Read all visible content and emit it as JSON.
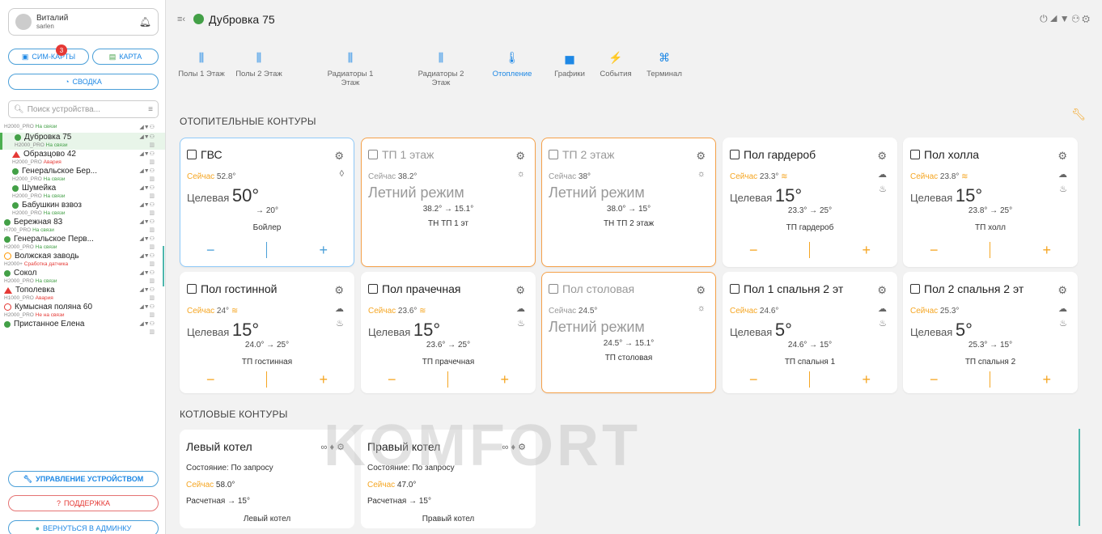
{
  "user": {
    "name": "Виталий",
    "login": "sarlen"
  },
  "sidebar": {
    "sim_label": "СИМ-КАРТЫ",
    "sim_badge": "3",
    "map_label": "КАРТА",
    "summary_label": "СВОДКА",
    "search_placeholder": "Поиск устройства...",
    "devices": [
      {
        "name": "",
        "model": "H2000_PRO",
        "status": "На связи",
        "state": "ok",
        "sub": false
      },
      {
        "name": "Дубровка 75",
        "model": "H2000_PRO",
        "status": "На связи",
        "state": "ok",
        "sub": true
      },
      {
        "name": "Образцово 42",
        "model": "H2000_PRO",
        "status": "Авария",
        "state": "alarm",
        "sub": true
      },
      {
        "name": "Генеральское Бер...",
        "model": "H2000_PRO",
        "status": "На связи",
        "state": "ok",
        "sub": true
      },
      {
        "name": "Шумейка",
        "model": "H2000_PRO",
        "status": "На связи",
        "state": "ok",
        "sub": true
      },
      {
        "name": "Бабушкин взвоз",
        "model": "H2000_PRO",
        "status": "На связи",
        "state": "ok",
        "sub": true
      },
      {
        "name": "Бережная 83",
        "model": "H700_PRO",
        "status": "На связи",
        "state": "ok",
        "sub": false
      },
      {
        "name": "Генеральское Перв...",
        "model": "H2000_PRO",
        "status": "На связи",
        "state": "ok",
        "sub": false
      },
      {
        "name": "Волжская заводь",
        "model": "H2000+",
        "status": "Сработка датчика",
        "state": "sensor",
        "sub": false
      },
      {
        "name": "Сокол",
        "model": "H2000_PRO",
        "status": "На связи",
        "state": "ok",
        "sub": false
      },
      {
        "name": "Тополевка",
        "model": "H1000_PRO",
        "status": "Авария",
        "state": "alarm",
        "sub": false
      },
      {
        "name": "Кумысная поляна 60",
        "model": "H2000_PRO",
        "status": "Не на связи",
        "state": "offline",
        "sub": false
      },
      {
        "name": "Пристанное Елена",
        "model": "",
        "status": "",
        "state": "ok",
        "sub": false
      }
    ],
    "manage_label": "УПРАВЛЕНИЕ УСТРОЙСТВОМ",
    "support_label": "ПОДДЕРЖКА",
    "admin_label": "ВЕРНУТЬСЯ В АДМИНКУ"
  },
  "header": {
    "title": "Дубровка 75"
  },
  "tabs": [
    {
      "label": "Полы 1 Этаж"
    },
    {
      "label": "Полы 2 Этаж"
    },
    {
      "label": "Радиаторы 1 Этаж"
    },
    {
      "label": "Радиаторы 2 Этаж"
    },
    {
      "label": "Отопление"
    },
    {
      "label": "Графики"
    },
    {
      "label": "События"
    },
    {
      "label": "Терминал"
    }
  ],
  "sections": {
    "heating": "ОТОПИТЕЛЬНЫЕ КОНТУРЫ",
    "boilers": "КОТЛОВЫЕ КОНТУРЫ"
  },
  "labels": {
    "now": "Сейчас",
    "target": "Целевая",
    "summer": "Летний режим"
  },
  "cards": [
    {
      "title": "ГВС",
      "now": "52.8°",
      "target": "50°",
      "line3": "→ 20°",
      "name": "Бойлер"
    },
    {
      "title": "ТП 1 этаж",
      "now": "38.2°",
      "line3": "38.2° → 15.1°",
      "name": "ТН ТП 1 эт"
    },
    {
      "title": "ТП 2 этаж",
      "now": "38°",
      "line3": "38.0° → 15°",
      "name": "ТН ТП 2 этаж"
    },
    {
      "title": "Пол гардероб",
      "now": "23.3°",
      "target": "15°",
      "line3": "23.3° → 25°",
      "name": "ТП гардероб"
    },
    {
      "title": "Пол холла",
      "now": "23.8°",
      "target": "15°",
      "line3": "23.8° → 25°",
      "name": "ТП холл"
    },
    {
      "title": "Пол гостинной",
      "now": "24°",
      "target": "15°",
      "line3": "24.0° → 25°",
      "name": "ТП гостинная"
    },
    {
      "title": "Пол прачечная",
      "now": "23.6°",
      "target": "15°",
      "line3": "23.6° → 25°",
      "name": "ТП прачечная"
    },
    {
      "title": "Пол столовая",
      "now": "24.5°",
      "line3": "24.5° → 15.1°",
      "name": "ТП столовая"
    },
    {
      "title": "Пол 1 спальня 2 эт",
      "now": "24.6°",
      "target": "5°",
      "line3": "24.6° → 15°",
      "name": "ТП спальня 1"
    },
    {
      "title": "Пол 2 спальня 2 эт",
      "now": "25.3°",
      "target": "5°",
      "line3": "25.3° → 15°",
      "name": "ТП спальня 2"
    }
  ],
  "boilers": [
    {
      "title": "Левый котел",
      "state": "Состояние: По запросу",
      "now": "58.0°",
      "calc": "Расчетная → 15°",
      "name": "Левый котел"
    },
    {
      "title": "Правый котел",
      "state": "Состояние: По запросу",
      "now": "47.0°",
      "calc": "Расчетная → 15°",
      "name": "Правый котел"
    }
  ],
  "watermark": "KOMFORT",
  "colors": {
    "accent": "#1e88e5",
    "ok": "#43a047",
    "alarm": "#e53935",
    "warn": "#f5a623"
  }
}
